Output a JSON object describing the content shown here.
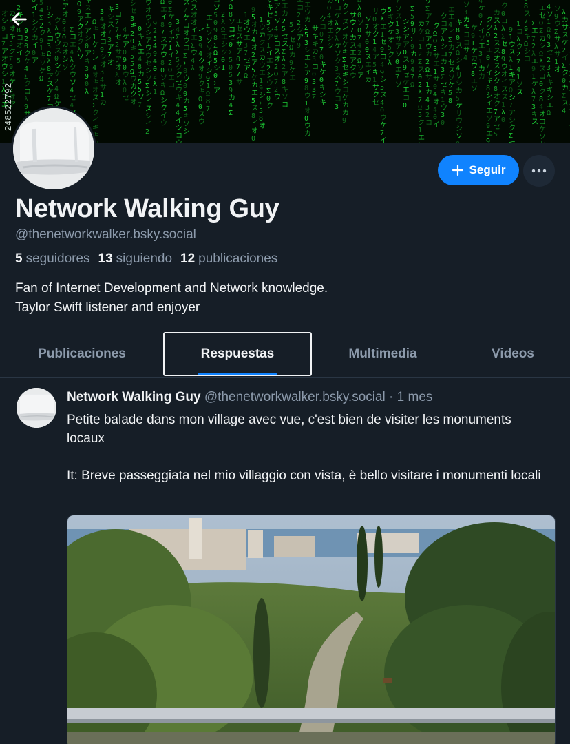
{
  "banner": {
    "id_text": "248522792"
  },
  "profile": {
    "display_name": "Network Walking Guy",
    "handle": "@thenetworkwalker.bsky.social",
    "followers_count": "5",
    "followers_label": "seguidores",
    "following_count": "13",
    "following_label": "siguiendo",
    "posts_count": "12",
    "posts_label": "publicaciones",
    "bio_line1": "Fan of Internet Development and Network knowledge.",
    "bio_line2": "Taylor Swift listener and enjoyer"
  },
  "actions": {
    "follow_label": "Seguir",
    "back_icon": "arrow-left-icon",
    "more_icon": "ellipsis-icon"
  },
  "tabs": [
    {
      "label": "Publicaciones",
      "active": false
    },
    {
      "label": "Respuestas",
      "active": true
    },
    {
      "label": "Multimedia",
      "active": false
    },
    {
      "label": "Videos",
      "active": false
    }
  ],
  "post": {
    "author": "Network Walking Guy",
    "meta": "@thenetworkwalker.bsky.social · 1 mes",
    "paragraph1": "Petite balade dans mon village avec vue, c'est bien de visiter les monuments locaux",
    "paragraph2": "It: Breve passeggiata nel mio villaggio con vista, è bello visitare i monumenti locali"
  },
  "colors": {
    "background": "#161e27",
    "accent": "#1083fe",
    "muted_text": "#8c9aab",
    "banner_green": "#1fdc3a"
  }
}
